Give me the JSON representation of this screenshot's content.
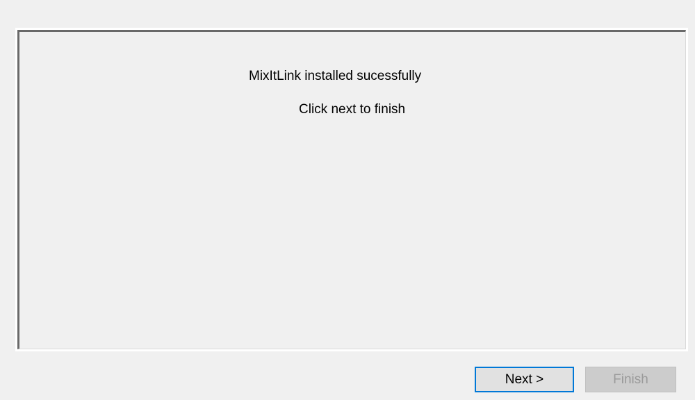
{
  "message": {
    "line1": "MixItLink installed sucessfully",
    "line2": "Click next to finish"
  },
  "buttons": {
    "next_label": "Next >",
    "finish_label": "Finish",
    "finish_enabled": false
  },
  "colors": {
    "focus_border": "#0078d7",
    "panel_background": "#f0f0f0",
    "disabled_button": "#cccccc"
  }
}
